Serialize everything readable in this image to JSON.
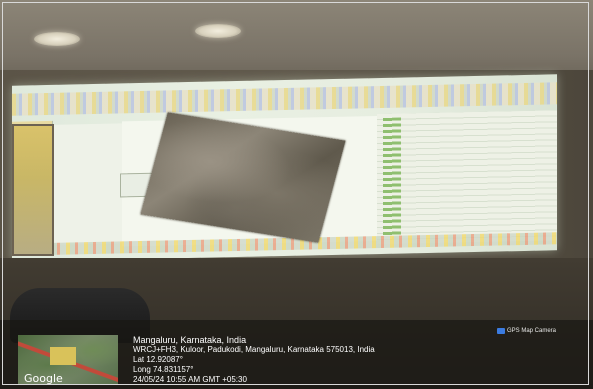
{
  "overlay": {
    "location": "Mangaluru, Karnataka, India",
    "address": "WRCJ+FH3, Kuloor, Padukodi, Mangaluru, Karnataka 575013, India",
    "lat": "Lat 12.92087°",
    "long": "Long 74.831157°",
    "datetime": "24/05/24 10:55 AM GMT +05:30",
    "app_badge": "GPS Map Camera",
    "map_logo": "Google"
  },
  "icons": {
    "camera": "camera-icon"
  }
}
